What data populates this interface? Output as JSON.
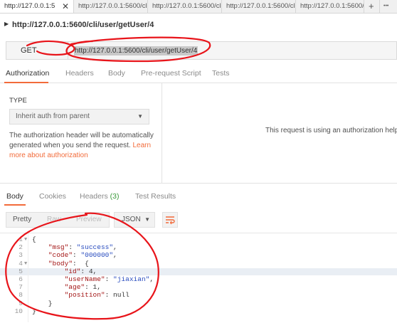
{
  "tabs": [
    {
      "label": "http://127.0.0.1:5",
      "close": "✕"
    },
    {
      "label": "http://127.0.0.1:5600/cli"
    },
    {
      "label": "http://127.0.0.1:5600/cli"
    },
    {
      "label": "http://127.0.0.1:5600/cli"
    },
    {
      "label": "http://127.0.0.1:5600/cli"
    }
  ],
  "tab_actions": {
    "add": "+",
    "more": "•••"
  },
  "request": {
    "name": "http://127.0.0.1:5600/cli/user/getUser/4",
    "method": "GET",
    "url": "http://127.0.0.1:5600/cli/user/getUser/4"
  },
  "request_tabs": [
    "Authorization",
    "Headers",
    "Body",
    "Pre-request Script",
    "Tests"
  ],
  "auth": {
    "type_label": "TYPE",
    "type_value": "Inherit auth from parent",
    "description": "The authorization header will be automatically generated when you send the request. ",
    "learn_more": "Learn more about authorization",
    "right_message": "This request is using an authorization help"
  },
  "response_tabs": {
    "body": "Body",
    "cookies": "Cookies",
    "headers": "Headers",
    "headers_count": "(3)",
    "test_results": "Test Results"
  },
  "format": {
    "pretty": "Pretty",
    "raw": "Raw",
    "preview": "Preview",
    "language": "JSON"
  },
  "response_lines": [
    {
      "n": "1",
      "fold": "▼",
      "text": "{"
    },
    {
      "n": "2",
      "key": "\"msg\"",
      "val": "\"success\"",
      "tail": ","
    },
    {
      "n": "3",
      "key": "\"code\"",
      "val": "\"000000\"",
      "tail": ","
    },
    {
      "n": "4",
      "fold": "▼",
      "key": "\"body\"",
      "tail": " {"
    },
    {
      "n": "5",
      "key": "\"id\"",
      "val": "4",
      "tail": ",",
      "indent": 2
    },
    {
      "n": "6",
      "key": "\"userName\"",
      "val": "\"jiaxian\"",
      "tail": ",",
      "indent": 2
    },
    {
      "n": "7",
      "key": "\"age\"",
      "val": "1",
      "tail": ",",
      "indent": 2
    },
    {
      "n": "8",
      "key": "\"position\"",
      "val": "null",
      "indent": 2
    },
    {
      "n": "9",
      "text": "    }"
    },
    {
      "n": "10",
      "text": "}"
    }
  ],
  "colors": {
    "accent": "#f26b3a",
    "annotation": "#e8141a",
    "count": "#3a9a3a"
  }
}
